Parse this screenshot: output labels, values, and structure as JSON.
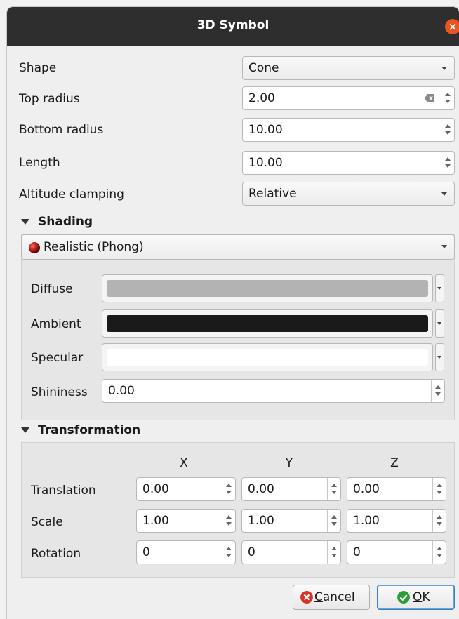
{
  "window": {
    "title": "3D Symbol"
  },
  "form": {
    "shape_label": "Shape",
    "shape_value": "Cone",
    "top_radius_label": "Top radius",
    "top_radius_value": "2.00",
    "bottom_radius_label": "Bottom radius",
    "bottom_radius_value": "10.00",
    "length_label": "Length",
    "length_value": "10.00",
    "altitude_label": "Altitude clamping",
    "altitude_value": "Relative"
  },
  "shading": {
    "header": "Shading",
    "model": "Realistic (Phong)",
    "diffuse_label": "Diffuse",
    "ambient_label": "Ambient",
    "specular_label": "Specular",
    "shininess_label": "Shininess",
    "shininess_value": "0.00",
    "colors": {
      "diffuse": "#b3b3b3",
      "ambient": "#1a1a1a",
      "specular": "#ffffff"
    }
  },
  "transformation": {
    "header": "Transformation",
    "axes": [
      "X",
      "Y",
      "Z"
    ],
    "rows": [
      {
        "label": "Translation",
        "values": [
          "0.00",
          "0.00",
          "0.00"
        ]
      },
      {
        "label": "Scale",
        "values": [
          "1.00",
          "1.00",
          "1.00"
        ]
      },
      {
        "label": "Rotation",
        "values": [
          "0",
          "0",
          "0"
        ]
      }
    ]
  },
  "buttons": {
    "cancel_pre": "",
    "cancel_u": "C",
    "cancel_rest": "ancel",
    "ok_u": "O",
    "ok_rest": "K"
  },
  "accent": {
    "close": "#e95420",
    "cancel_icon": "#d9322a",
    "ok_icon": "#2a9d3a",
    "phong_sphere": "#b01818"
  }
}
